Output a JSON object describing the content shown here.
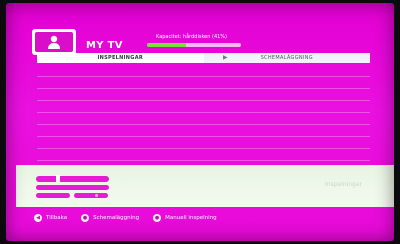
{
  "header": {
    "title": "MY TV",
    "capacity_label": "Kapacitet: hårddisken (41%)",
    "capacity_percent": 41
  },
  "tabs": [
    {
      "label": "INSPELNINGAR",
      "active": true
    },
    {
      "label": "SCHEMALÄGGNING",
      "active": false
    }
  ],
  "info_panel": {
    "right_text": "Inspelningar"
  },
  "footer": {
    "hints": [
      {
        "label": "Tillbaka",
        "icon": "back-icon"
      },
      {
        "label": "Schemaläggning",
        "icon": "red-button-icon"
      },
      {
        "label": "Manuell inspelning",
        "icon": "green-button-icon"
      }
    ]
  },
  "colors": {
    "background": "#e200d2",
    "capacity_fill": "#7adf3c",
    "panel": "#eef7ea"
  }
}
